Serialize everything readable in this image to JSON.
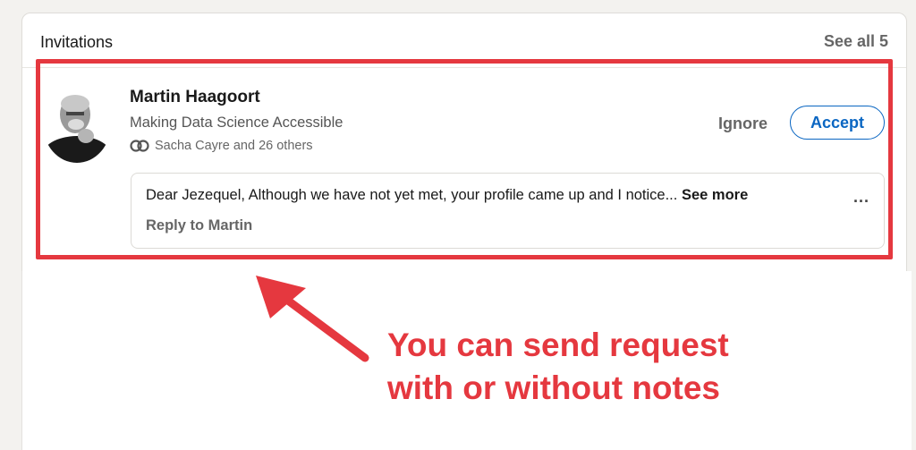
{
  "card": {
    "title": "Invitations",
    "see_all": "See all 5"
  },
  "invitation": {
    "name": "Martin Haagoort",
    "headline": "Making Data Science Accessible",
    "mutual_connections": "Sacha Cayre and 26 others",
    "ignore_label": "Ignore",
    "accept_label": "Accept",
    "message_preview": "Dear Jezequel, Although we have not yet met, your profile came up and I notice...",
    "see_more_label": "See more",
    "more_options": "...",
    "reply_label": "Reply to Martin"
  },
  "annotation": {
    "line1": "You can send request",
    "line2": "with or without notes",
    "color": "#e5383f"
  },
  "colors": {
    "accent": "#0a66c2",
    "highlight": "#e5383f"
  }
}
